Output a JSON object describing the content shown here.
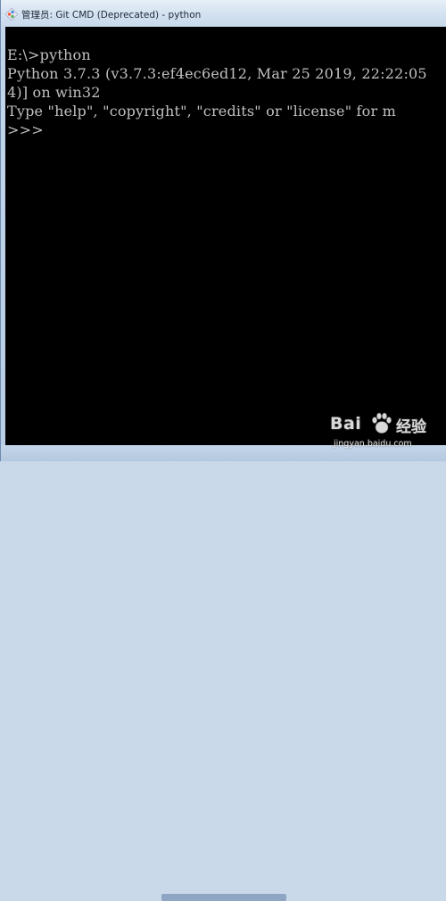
{
  "window": {
    "title": "管理员: Git CMD (Deprecated) - python"
  },
  "console": {
    "lines": [
      "E:\\>python",
      "Python 3.7.3 (v3.7.3:ef4ec6ed12, Mar 25 2019, 22:22:05",
      "4)] on win32",
      "Type \"help\", \"copyright\", \"credits\" or \"license\" for m",
      ">>>"
    ],
    "text_color": "#c0c0c0",
    "background": "#000000"
  },
  "watermark": {
    "brand_left": "Bai",
    "brand_right": "经验",
    "url": "jingyan.baidu.com",
    "icon": "baidu-paw-icon"
  }
}
